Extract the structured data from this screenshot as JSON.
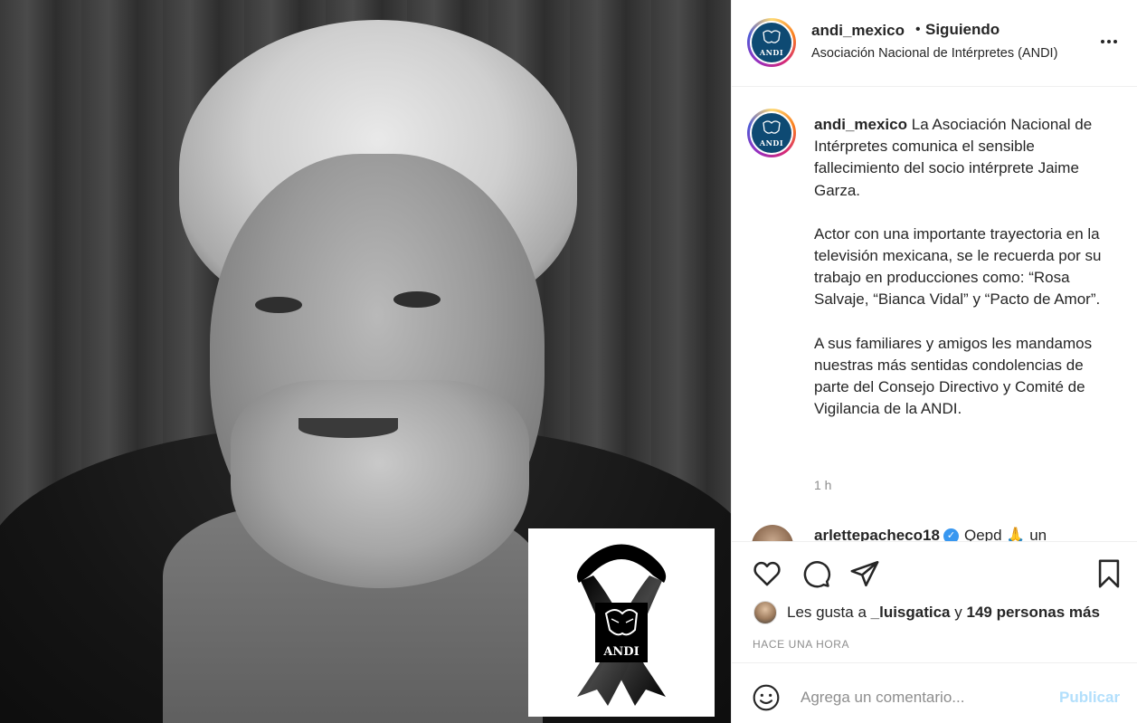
{
  "post": {
    "image_alt": "Black and white portrait of Jaime Garza with ANDI mourning ribbon",
    "ribbon_logo_text": "ANDI"
  },
  "header": {
    "username": "andi_mexico",
    "dot": "•",
    "follow_status": "Siguiendo",
    "subtitle": "Asociación Nacional de Intérpretes (ANDI)",
    "avatar_text": "ANDI"
  },
  "caption": {
    "username": "andi_mexico",
    "paragraph1": "La Asociación Nacional de Intérpretes comunica el sensible fallecimiento del socio intérprete Jaime Garza.",
    "paragraph2": "Actor con una importante trayectoria en la televisión mexicana, se le recuerda por su trabajo en producciones como: “Rosa Salvaje, “Bianca Vidal” y “Pacto de Amor”.",
    "paragraph3": "A sus familiares y amigos les mandamos nuestras más sentidas condolencias de parte del Consejo Directivo y Comité de Vigilancia de la ANDI.",
    "time_ago": "1 h"
  },
  "comment_peek": {
    "username": "arlettepacheco18",
    "verified_icon": "✓",
    "text": "Qepd 🙏 un"
  },
  "likes": {
    "prefix": "Les gusta a",
    "user": "_luisgatica",
    "conjunction": "y",
    "others": "149 personas más"
  },
  "posted_time": "HACE UNA HORA",
  "add_comment": {
    "placeholder": "Agrega un comentario...",
    "post_button": "Publicar"
  },
  "colors": {
    "accent_blue": "#0095f6",
    "disabled_blue": "#b2dffc",
    "muted": "#8e8e8e",
    "text": "#262626",
    "andi_blue": "#0e4a73"
  }
}
